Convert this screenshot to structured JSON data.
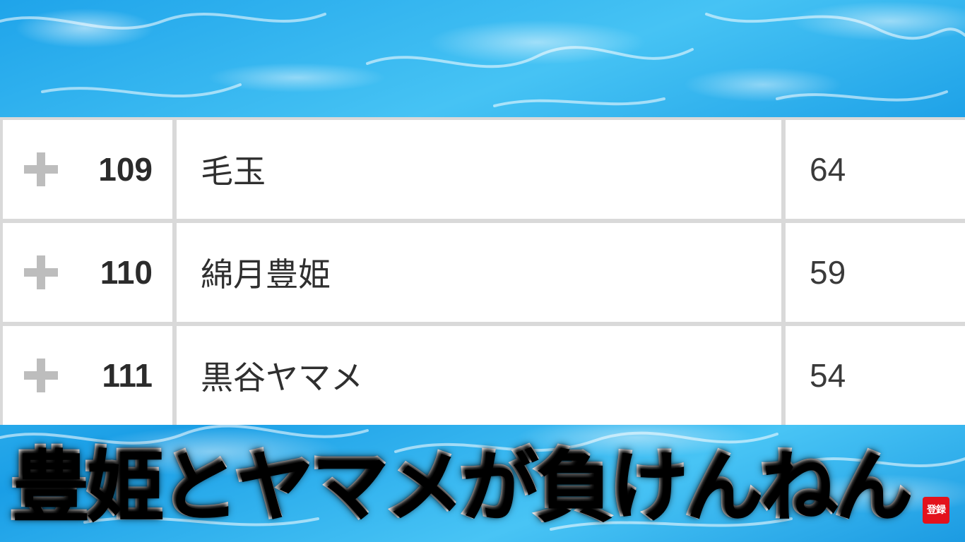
{
  "ranking": {
    "rows": [
      {
        "rank": "109",
        "name": "毛玉",
        "score": "64"
      },
      {
        "rank": "110",
        "name": "綿月豊姫",
        "score": "59"
      },
      {
        "rank": "111",
        "name": "黒谷ヤマメ",
        "score": "54"
      }
    ]
  },
  "caption": {
    "text": "豊姫とヤマメが負けんねん"
  },
  "subscribe_badge": {
    "label": "登録"
  },
  "colors": {
    "water": "#2aa8e6",
    "grid": "#d9d9d9",
    "caption_red": "#b5000c",
    "badge_red": "#e3121c"
  }
}
